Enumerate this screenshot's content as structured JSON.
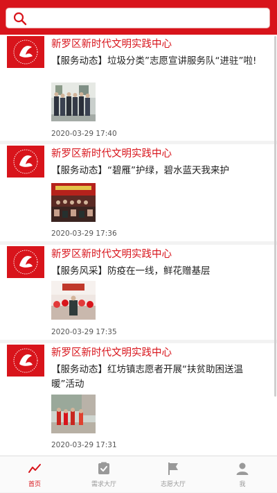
{
  "search": {
    "icon": "search-icon"
  },
  "feed": {
    "items": [
      {
        "org": "新罗区新时代文明实践中心",
        "title": "【服务动态】垃圾分类”志愿宣讲服务队“进驻”啦!",
        "time": "2020-03-29 17:40",
        "thumb": "group-photo"
      },
      {
        "org": "新罗区新时代文明实践中心",
        "title": "【服务动态】“碧雁”护绿，碧水蓝天我来护",
        "time": "2020-03-29 17:36",
        "thumb": "meeting-photo"
      },
      {
        "org": "新罗区新时代文明实践中心",
        "title": "【服务风采】防疫在一线，鲜花赠基层",
        "time": "2020-03-29 17:35",
        "thumb": "flowers-photo"
      },
      {
        "org": "新罗区新时代文明实践中心",
        "title": "【服务动态】红坊镇志愿者开展“扶贫助困送温暖”活动",
        "time": "2020-03-29 17:31",
        "thumb": "street-photo"
      }
    ]
  },
  "tabs": [
    {
      "label": "首页",
      "icon": "trend-icon",
      "active": true
    },
    {
      "label": "需求大厅",
      "icon": "clipboard-check-icon",
      "active": false
    },
    {
      "label": "志愿大厅",
      "icon": "flag-icon",
      "active": false
    },
    {
      "label": "我",
      "icon": "person-icon",
      "active": false
    }
  ],
  "colors": {
    "accent": "#d8141b",
    "inactive": "#999999"
  }
}
